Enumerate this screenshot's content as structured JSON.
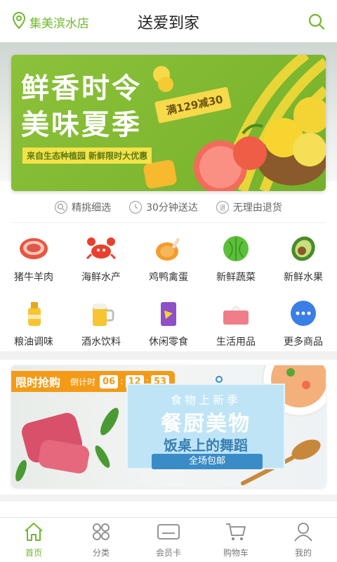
{
  "header": {
    "store_name": "集美滨水店",
    "title": "送爱到家"
  },
  "banner": {
    "headline_1": "鲜香时令",
    "headline_2": "美味夏季",
    "tag": "满129减30",
    "subtitle": "来自生态种植园 新鲜限时大优惠"
  },
  "promises": [
    {
      "label": "精挑细选",
      "icon": "search-icon"
    },
    {
      "label": "30分钟送达",
      "icon": "clock-icon"
    },
    {
      "label": "无理由退货",
      "icon": "return-icon"
    }
  ],
  "categories": [
    {
      "label": "猪牛羊肉",
      "icon": "meat-icon"
    },
    {
      "label": "海鲜水产",
      "icon": "crab-icon"
    },
    {
      "label": "鸡鸭禽蛋",
      "icon": "chicken-icon"
    },
    {
      "label": "新鲜蔬菜",
      "icon": "cabbage-icon"
    },
    {
      "label": "新鲜水果",
      "icon": "avocado-icon"
    },
    {
      "label": "粮油调味",
      "icon": "oil-icon"
    },
    {
      "label": "酒水饮料",
      "icon": "beer-icon"
    },
    {
      "label": "休闲零食",
      "icon": "snack-icon"
    },
    {
      "label": "生活用品",
      "icon": "tissue-icon"
    },
    {
      "label": "更多商品",
      "icon": "more-icon"
    }
  ],
  "flash_sale": {
    "title": "限时抢购",
    "countdown_label": "倒计时",
    "hours": "06",
    "minutes": "12",
    "seconds": "53",
    "kicker": "食物上新季",
    "main": "餐厨美物",
    "sub": "饭桌上的舞蹈",
    "pill": "全场包邮"
  },
  "nav": [
    {
      "label": "首页",
      "icon": "home-icon",
      "active": true
    },
    {
      "label": "分类",
      "icon": "grid-icon",
      "active": false
    },
    {
      "label": "会员卡",
      "icon": "card-icon",
      "active": false
    },
    {
      "label": "购物车",
      "icon": "cart-icon",
      "active": false
    },
    {
      "label": "我的",
      "icon": "user-icon",
      "active": false
    }
  ],
  "colors": {
    "accent": "#6fb92c",
    "flash": "#f39b19"
  }
}
